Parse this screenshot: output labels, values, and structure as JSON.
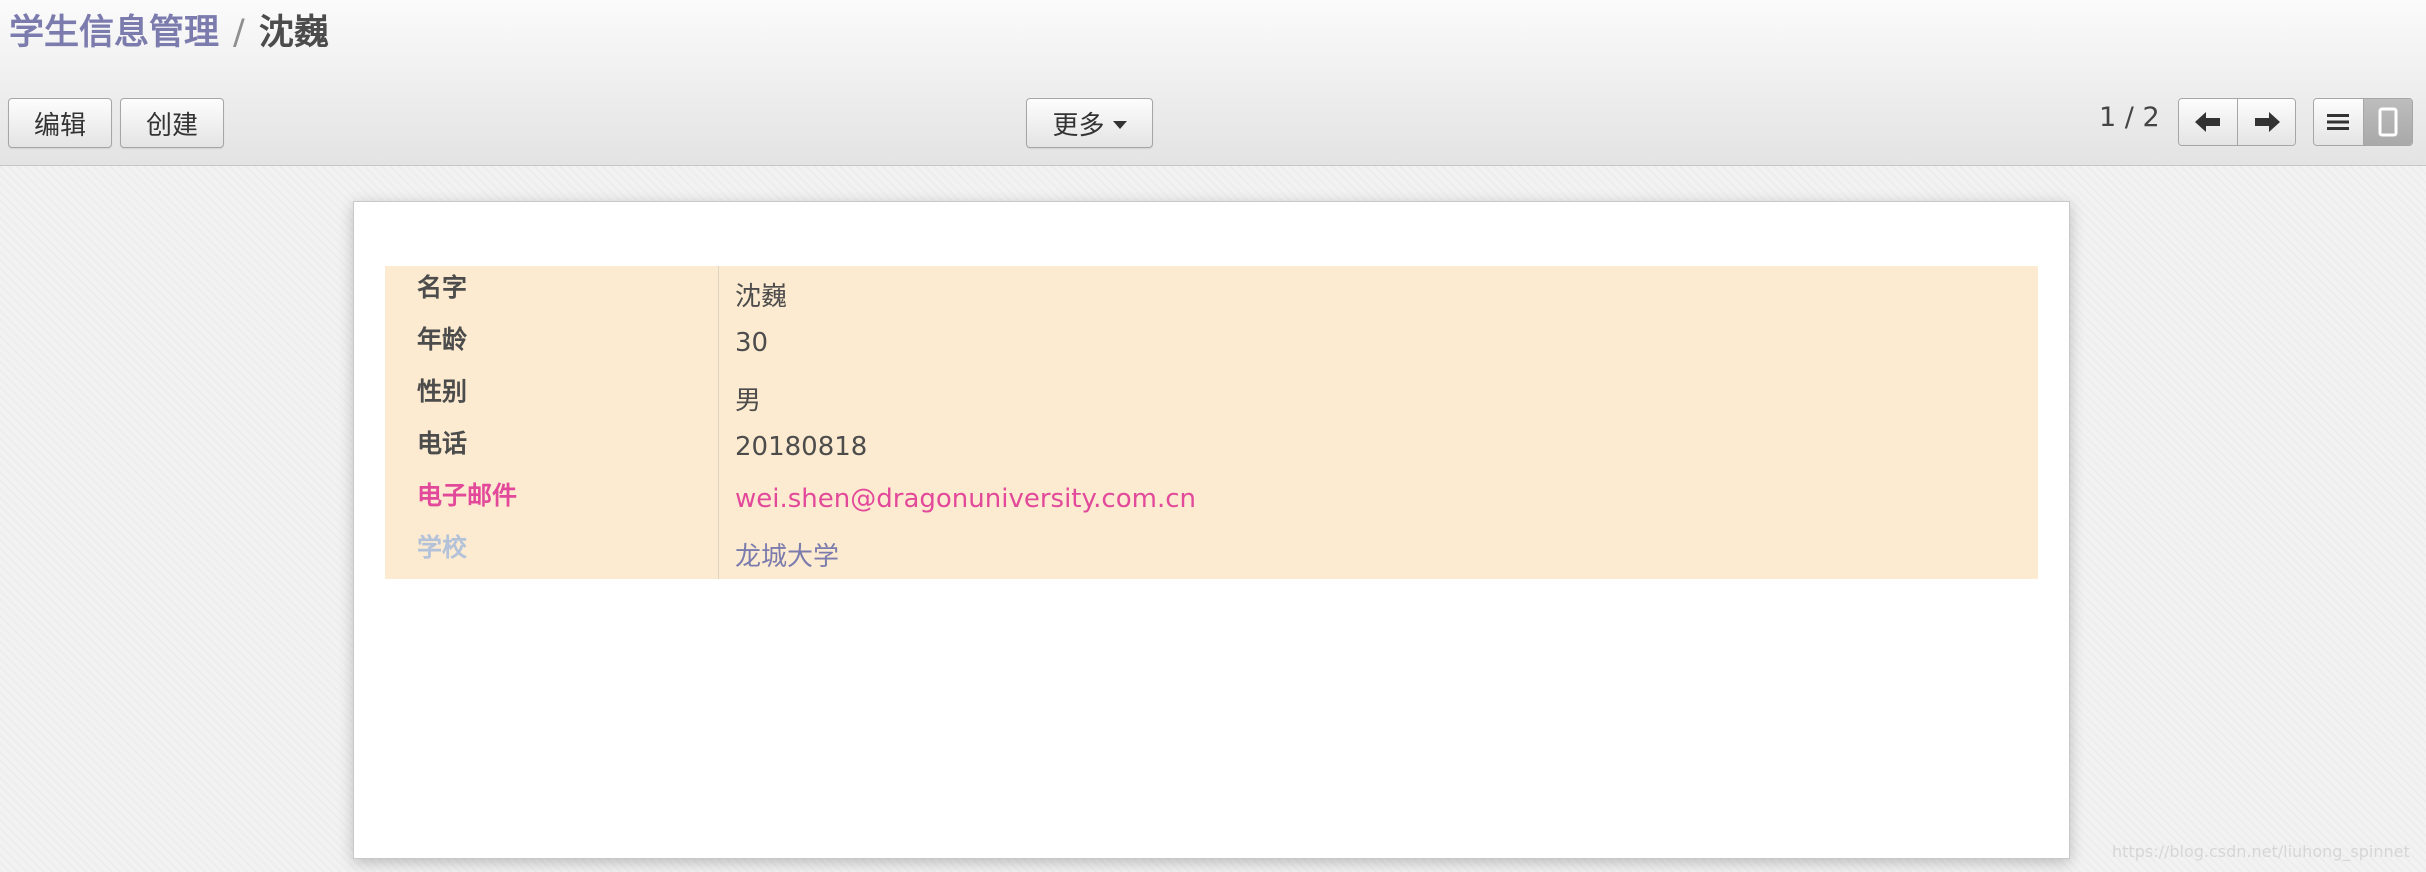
{
  "breadcrumb": {
    "parent": "学生信息管理",
    "separator": "/",
    "current": "沈巍"
  },
  "toolbar": {
    "edit_label": "编辑",
    "create_label": "创建",
    "more_label": "更多"
  },
  "pager": {
    "value": "1 / 2"
  },
  "view_switcher": {
    "views": [
      "list",
      "form"
    ],
    "active": "form"
  },
  "record": {
    "fields": [
      {
        "label": "名字",
        "value": "沈巍",
        "label_color": "#4c4c4c",
        "value_color": "#4c4c4c"
      },
      {
        "label": "年龄",
        "value": "30",
        "label_color": "#4c4c4c",
        "value_color": "#4c4c4c"
      },
      {
        "label": "性别",
        "value": "男",
        "label_color": "#4c4c4c",
        "value_color": "#4c4c4c"
      },
      {
        "label": "电话",
        "value": "20180818",
        "label_color": "#4c4c4c",
        "value_color": "#4c4c4c"
      },
      {
        "label": "电子邮件",
        "value": "wei.shen@dragonuniversity.com.cn",
        "label_color": "#e3499a",
        "value_color": "#e3499a"
      },
      {
        "label": "学校",
        "value": "龙城大学",
        "label_color": "#b3c2d9",
        "value_color": "#7c7bad"
      }
    ]
  },
  "watermark": "https://blog.csdn.net/liuhong_spinnet",
  "colors": {
    "breadcrumb_link": "#7c7bad",
    "row_background": "#fcebd0",
    "email": "#e3499a",
    "muted_label": "#b3c2d9"
  }
}
